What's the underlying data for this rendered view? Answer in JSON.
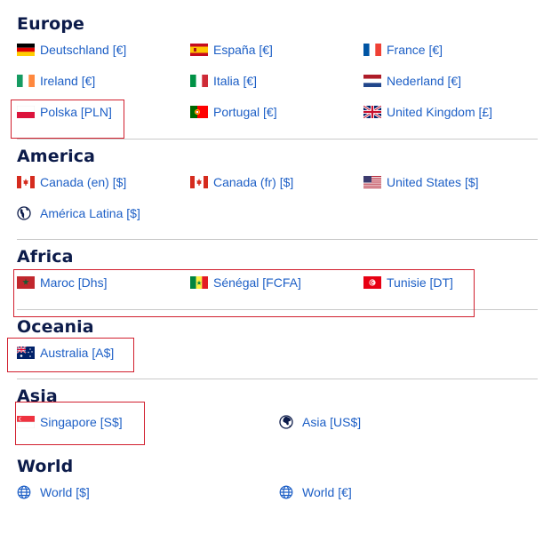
{
  "regions": {
    "europe": {
      "title": "Europe",
      "countries": [
        {
          "label": "Deutschland [€]",
          "flag": "flag-germany"
        },
        {
          "label": "España [€]",
          "flag": "flag-spain"
        },
        {
          "label": "France [€]",
          "flag": "flag-france"
        },
        {
          "label": "Ireland [€]",
          "flag": "flag-ireland"
        },
        {
          "label": "Italia [€]",
          "flag": "flag-italy"
        },
        {
          "label": "Nederland [€]",
          "flag": "flag-netherlands"
        },
        {
          "label": "Polska [PLN]",
          "flag": "flag-poland"
        },
        {
          "label": "Portugal [€]",
          "flag": "flag-portugal"
        },
        {
          "label": "United Kingdom [£]",
          "flag": "flag-united-kingdom"
        }
      ]
    },
    "america": {
      "title": "America",
      "countries": [
        {
          "label": "Canada (en) [$]",
          "flag": "flag-canada"
        },
        {
          "label": "Canada (fr) [$]",
          "flag": "flag-canada"
        },
        {
          "label": "United States [$]",
          "flag": "flag-united-states"
        },
        {
          "label": "América Latina [$]",
          "flag": "globe-americas-icon"
        }
      ]
    },
    "africa": {
      "title": "Africa",
      "countries": [
        {
          "label": "Maroc [Dhs]",
          "flag": "flag-morocco"
        },
        {
          "label": "Sénégal [FCFA]",
          "flag": "flag-senegal"
        },
        {
          "label": "Tunisie [DT]",
          "flag": "flag-tunisia"
        }
      ]
    },
    "oceania": {
      "title": "Oceania",
      "countries": [
        {
          "label": "Australia [A$]",
          "flag": "flag-australia"
        }
      ]
    },
    "asia": {
      "title": "Asia",
      "countries": [
        {
          "label": "Singapore [S$]",
          "flag": "flag-singapore"
        },
        {
          "label": "Asia [US$]",
          "flag": "globe-asia-icon"
        }
      ]
    },
    "world": {
      "title": "World",
      "countries": [
        {
          "label": "World [$]",
          "flag": "globe-icon"
        },
        {
          "label": "World [€]",
          "flag": "globe-icon"
        }
      ]
    }
  },
  "colors": {
    "heading": "#0c1b4a",
    "link": "#1d5fc6",
    "divider": "#c9c9c9",
    "highlight_box": "#d11f2e"
  }
}
